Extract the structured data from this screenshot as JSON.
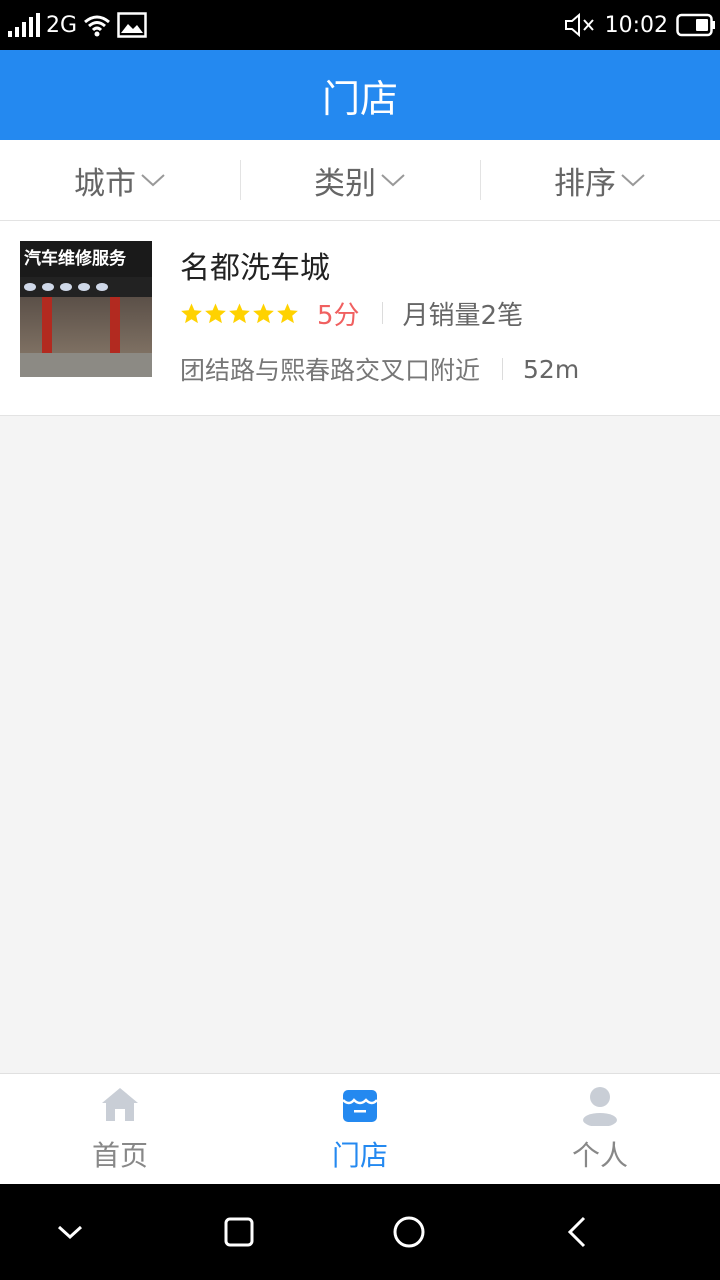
{
  "status_bar": {
    "network": "2G",
    "time": "10:02",
    "icons": [
      "signal-icon",
      "wifi-icon",
      "image-icon",
      "mute-icon",
      "battery-icon"
    ]
  },
  "header": {
    "title": "门店",
    "background": "#2489f0"
  },
  "filters": [
    {
      "label": "城市",
      "icon": "chevron-down-icon"
    },
    {
      "label": "类别",
      "icon": "chevron-down-icon"
    },
    {
      "label": "排序",
      "icon": "chevron-down-icon"
    }
  ],
  "stores": [
    {
      "name": "名都洗车城",
      "stars": 5,
      "score": "5分",
      "sales": "月销量2笔",
      "address": "团结路与熙春路交叉口附近",
      "distance": "52m",
      "thumbnail_sign": "汽车维修服务"
    }
  ],
  "tab_bar": {
    "tabs": [
      {
        "label": "首页",
        "icon": "home-icon",
        "active": false
      },
      {
        "label": "门店",
        "icon": "store-icon",
        "active": true
      },
      {
        "label": "个人",
        "icon": "person-icon",
        "active": false
      }
    ],
    "active_color": "#2489f0",
    "inactive_color": "#888888"
  },
  "nav_bar": {
    "buttons": [
      "collapse-icon",
      "recents-icon",
      "home-circle-icon",
      "back-icon"
    ]
  },
  "colors": {
    "star": "#ffd200",
    "score": "#f06060"
  }
}
